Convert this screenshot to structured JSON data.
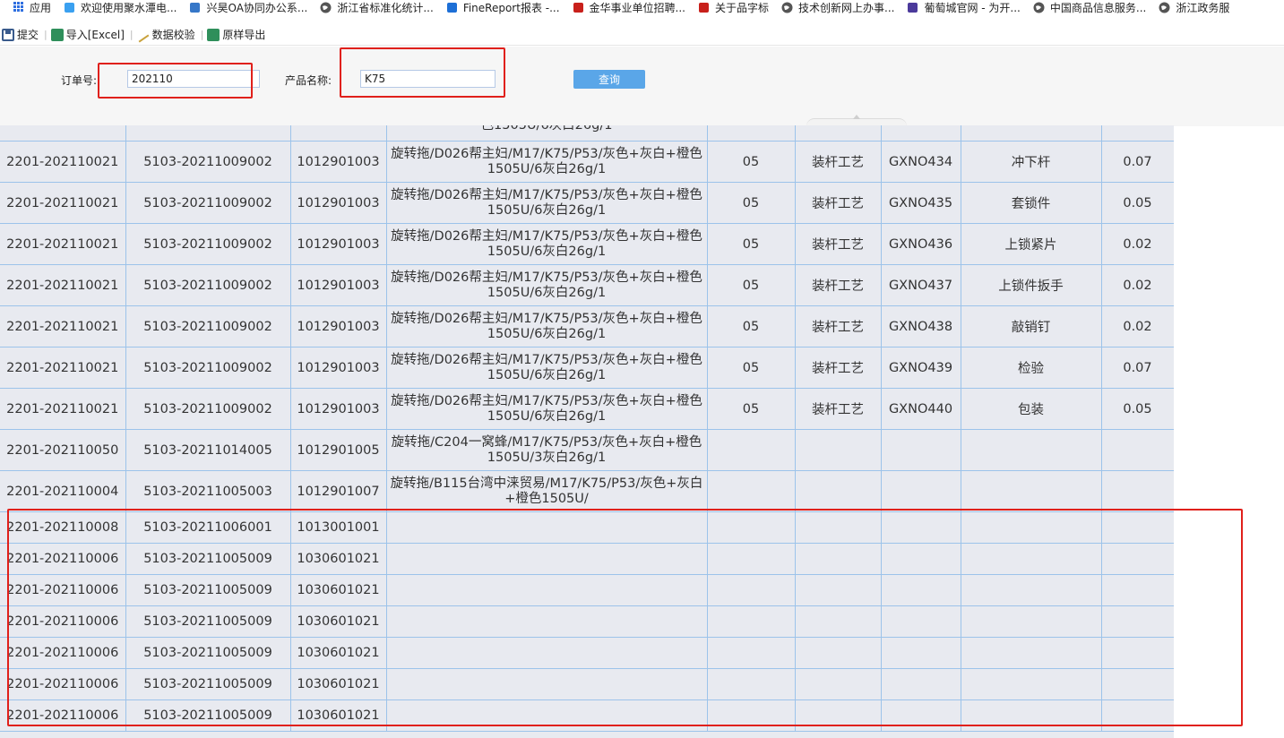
{
  "bookmarks": [
    {
      "label": "应用",
      "icon": "apps-grid-icon",
      "color": "#2f6fe0"
    },
    {
      "label": "欢迎使用聚水潭电...",
      "icon": "jushuitan-icon",
      "color": "#3aa0f0"
    },
    {
      "label": "兴昊OA协同办公系...",
      "icon": "seeyon-icon",
      "color": "#3677c8"
    },
    {
      "label": "浙江省标准化统计...",
      "icon": "globe-icon",
      "color": "#555555"
    },
    {
      "label": "FineReport报表 -...",
      "icon": "finereport-icon",
      "color": "#1d6fd6"
    },
    {
      "label": "金华事业单位招聘...",
      "icon": "jinhua-icon",
      "color": "#c8201b"
    },
    {
      "label": "关于品字标",
      "icon": "pinzibiao-icon",
      "color": "#c8201b"
    },
    {
      "label": "技术创新网上办事...",
      "icon": "globe-icon",
      "color": "#555555"
    },
    {
      "label": "葡萄城官网 - 为开...",
      "icon": "grapecity-icon",
      "color": "#4b3a9b"
    },
    {
      "label": "中国商品信息服务...",
      "icon": "globe-icon",
      "color": "#555555"
    },
    {
      "label": "浙江政务服",
      "icon": "globe-icon",
      "color": "#555555"
    }
  ],
  "toolbar": {
    "submit": "提交",
    "import_excel": "导入[Excel]",
    "verify": "数据校验",
    "export": "原样导出",
    "separator": "|"
  },
  "query": {
    "order_label": "订单号:",
    "order_value": "202110",
    "product_label": "产品名称:",
    "product_value": "K75",
    "search_button": "查询"
  },
  "table": {
    "top_partial_name": "色1505U/6灰白26g/1",
    "rows": [
      {
        "c1": "2201-202110021",
        "c2": "5103-20211009002",
        "c3": "1012901003",
        "name": "旋转拖/D026帮主妇/M17/K75/P53/灰色+灰白+橙色1505U/6灰白26g/1",
        "c5": "05",
        "c6": "装杆工艺",
        "c7": "GXNO434",
        "c8": "冲下杆",
        "c9": "0.07"
      },
      {
        "c1": "2201-202110021",
        "c2": "5103-20211009002",
        "c3": "1012901003",
        "name": "旋转拖/D026帮主妇/M17/K75/P53/灰色+灰白+橙色1505U/6灰白26g/1",
        "c5": "05",
        "c6": "装杆工艺",
        "c7": "GXNO435",
        "c8": "套锁件",
        "c9": "0.05"
      },
      {
        "c1": "2201-202110021",
        "c2": "5103-20211009002",
        "c3": "1012901003",
        "name": "旋转拖/D026帮主妇/M17/K75/P53/灰色+灰白+橙色1505U/6灰白26g/1",
        "c5": "05",
        "c6": "装杆工艺",
        "c7": "GXNO436",
        "c8": "上锁紧片",
        "c9": "0.02"
      },
      {
        "c1": "2201-202110021",
        "c2": "5103-20211009002",
        "c3": "1012901003",
        "name": "旋转拖/D026帮主妇/M17/K75/P53/灰色+灰白+橙色1505U/6灰白26g/1",
        "c5": "05",
        "c6": "装杆工艺",
        "c7": "GXNO437",
        "c8": "上锁件扳手",
        "c9": "0.02"
      },
      {
        "c1": "2201-202110021",
        "c2": "5103-20211009002",
        "c3": "1012901003",
        "name": "旋转拖/D026帮主妇/M17/K75/P53/灰色+灰白+橙色1505U/6灰白26g/1",
        "c5": "05",
        "c6": "装杆工艺",
        "c7": "GXNO438",
        "c8": "敲销钉",
        "c9": "0.02"
      },
      {
        "c1": "2201-202110021",
        "c2": "5103-20211009002",
        "c3": "1012901003",
        "name": "旋转拖/D026帮主妇/M17/K75/P53/灰色+灰白+橙色1505U/6灰白26g/1",
        "c5": "05",
        "c6": "装杆工艺",
        "c7": "GXNO439",
        "c8": "检验",
        "c9": "0.07"
      },
      {
        "c1": "2201-202110021",
        "c2": "5103-20211009002",
        "c3": "1012901003",
        "name": "旋转拖/D026帮主妇/M17/K75/P53/灰色+灰白+橙色1505U/6灰白26g/1",
        "c5": "05",
        "c6": "装杆工艺",
        "c7": "GXNO440",
        "c8": "包装",
        "c9": "0.05"
      },
      {
        "c1": "2201-202110050",
        "c2": "5103-20211014005",
        "c3": "1012901005",
        "name": "旋转拖/C204一窝蜂/M17/K75/P53/灰色+灰白+橙色1505U/3灰白26g/1",
        "c5": "",
        "c6": "",
        "c7": "",
        "c8": "",
        "c9": ""
      },
      {
        "c1": "2201-202110004",
        "c2": "5103-20211005003",
        "c3": "1012901007",
        "name": "旋转拖/B115台湾中涞贸易/M17/K75/P53/灰色+灰白+橙色1505U/",
        "c5": "",
        "c6": "",
        "c7": "",
        "c8": "",
        "c9": ""
      },
      {
        "c1": "2201-202110008",
        "c2": "5103-20211006001",
        "c3": "1013001001",
        "name": "",
        "c5": "",
        "c6": "",
        "c7": "",
        "c8": "",
        "c9": ""
      },
      {
        "c1": "2201-202110006",
        "c2": "5103-20211005009",
        "c3": "1030601021",
        "name": "",
        "c5": "",
        "c6": "",
        "c7": "",
        "c8": "",
        "c9": ""
      },
      {
        "c1": "2201-202110006",
        "c2": "5103-20211005009",
        "c3": "1030601021",
        "name": "",
        "c5": "",
        "c6": "",
        "c7": "",
        "c8": "",
        "c9": ""
      },
      {
        "c1": "2201-202110006",
        "c2": "5103-20211005009",
        "c3": "1030601021",
        "name": "",
        "c5": "",
        "c6": "",
        "c7": "",
        "c8": "",
        "c9": ""
      },
      {
        "c1": "2201-202110006",
        "c2": "5103-20211005009",
        "c3": "1030601021",
        "name": "",
        "c5": "",
        "c6": "",
        "c7": "",
        "c8": "",
        "c9": ""
      },
      {
        "c1": "2201-202110006",
        "c2": "5103-20211005009",
        "c3": "1030601021",
        "name": "",
        "c5": "",
        "c6": "",
        "c7": "",
        "c8": "",
        "c9": ""
      },
      {
        "c1": "2201-202110006",
        "c2": "5103-20211005009",
        "c3": "1030601021",
        "name": "",
        "c5": "",
        "c6": "",
        "c7": "",
        "c8": "",
        "c9": ""
      }
    ]
  },
  "colors": {
    "highlight_border": "#e0201b",
    "grid_line": "#9cc3ea",
    "cell_bg": "#e8eaf0",
    "button_bg": "#5aa6e8"
  }
}
